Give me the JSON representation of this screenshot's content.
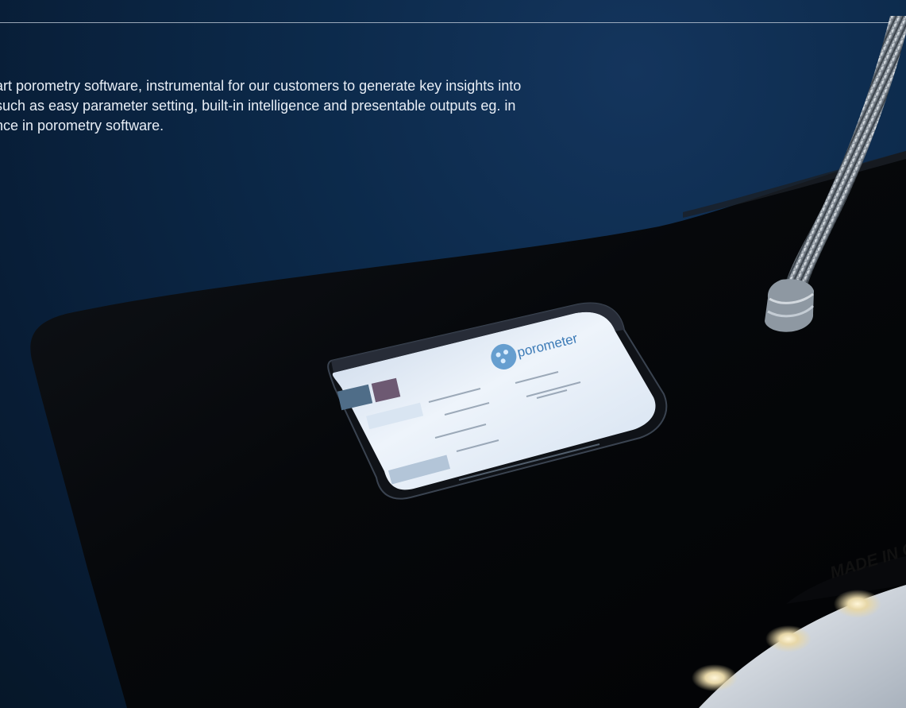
{
  "intro": {
    "line1": "art porometry software, instrumental for our customers to generate key insights into",
    "line2": "such as easy parameter setting, built-in intelligence and presentable outputs eg. in",
    "line3": "nce in porometry software."
  },
  "device": {
    "screen_brand": "porometer",
    "label_text": "MADE IN G"
  },
  "colors": {
    "background": "#0b2342",
    "text": "#e8eef6",
    "device": "#050608",
    "screen": "#e6ecf4"
  },
  "icons": {
    "logo": "dot-cluster-logo",
    "gooseneck": "gooseneck-lamp",
    "lights": "led-lights"
  }
}
